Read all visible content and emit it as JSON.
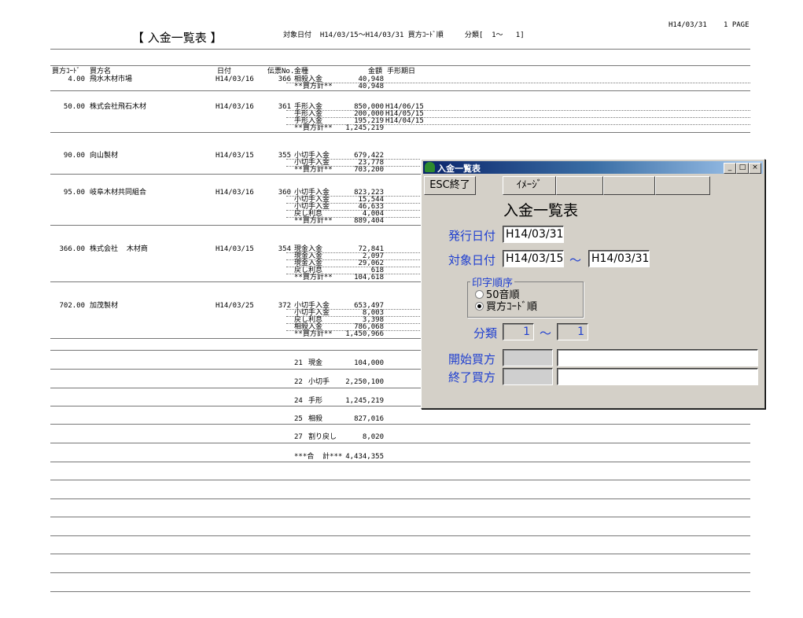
{
  "report": {
    "title": "【 入金一覧表 】",
    "criteria": "対象日付  H14/03/15～H14/03/31 買方ｺｰﾄﾞ順     分類[  1～   1]",
    "print_date": "H14/03/31",
    "page": "1 PAGE",
    "headers": {
      "code": "買方ｺｰﾄﾞ",
      "name": "買方名",
      "date": "日付",
      "slip": "伝票No.",
      "kind": "金種",
      "amount": "金額",
      "due": "手形期日"
    },
    "buyers": [
      {
        "code": "4.00",
        "name": "飛水木材市場",
        "date": "H14/03/16",
        "slip": "366",
        "lines": [
          {
            "kind": "相殺入金",
            "amount": "40,948",
            "due": ""
          },
          {
            "kind": "**買方計**",
            "amount": "40,948",
            "due": ""
          }
        ]
      },
      {
        "code": "50.00",
        "name": "株式会社飛石木材",
        "date": "H14/03/16",
        "slip": "361",
        "lines": [
          {
            "kind": "手形入金",
            "amount": "850,000",
            "due": "H14/06/15"
          },
          {
            "kind": "手形入金",
            "amount": "200,000",
            "due": "H14/05/15"
          },
          {
            "kind": "手形入金",
            "amount": "195,219",
            "due": "H14/04/15"
          },
          {
            "kind": "**買方計**",
            "amount": "1,245,219",
            "due": ""
          }
        ]
      },
      {
        "code": "90.00",
        "name": "向山製材",
        "date": "H14/03/15",
        "slip": "355",
        "lines": [
          {
            "kind": "小切手入金",
            "amount": "679,422",
            "due": ""
          },
          {
            "kind": "小切手入金",
            "amount": "23,778",
            "due": ""
          },
          {
            "kind": "**買方計**",
            "amount": "703,200",
            "due": ""
          }
        ]
      },
      {
        "code": "95.00",
        "name": "岐阜木材共同組合",
        "date": "H14/03/16",
        "slip": "360",
        "lines": [
          {
            "kind": "小切手入金",
            "amount": "823,223",
            "due": ""
          },
          {
            "kind": "小切手入金",
            "amount": "15,544",
            "due": ""
          },
          {
            "kind": "小切手入金",
            "amount": "46,633",
            "due": ""
          },
          {
            "kind": "戻し利息",
            "amount": "4,004",
            "due": ""
          },
          {
            "kind": "**買方計**",
            "amount": "889,404",
            "due": ""
          }
        ]
      },
      {
        "code": "366.00",
        "name": "株式会社  木材商",
        "date": "H14/03/15",
        "slip": "354",
        "lines": [
          {
            "kind": "現金入金",
            "amount": "72,841",
            "due": ""
          },
          {
            "kind": "現金入金",
            "amount": "2,097",
            "due": ""
          },
          {
            "kind": "現金入金",
            "amount": "29,062",
            "due": ""
          },
          {
            "kind": "戻し利息",
            "amount": "618",
            "due": ""
          },
          {
            "kind": "**買方計**",
            "amount": "104,618",
            "due": ""
          }
        ]
      },
      {
        "code": "702.00",
        "name": "加茂製材",
        "date": "H14/03/25",
        "slip": "372",
        "lines": [
          {
            "kind": "小切手入金",
            "amount": "653,497",
            "due": ""
          },
          {
            "kind": "小切手入金",
            "amount": "8,003",
            "due": ""
          },
          {
            "kind": "戻し利息",
            "amount": "3,398",
            "due": ""
          },
          {
            "kind": "相殺入金",
            "amount": "786,068",
            "due": ""
          },
          {
            "kind": "**買方計**",
            "amount": "1,450,966",
            "due": ""
          }
        ]
      }
    ],
    "summary": [
      {
        "code": "21",
        "kind": "現金",
        "amount": "104,000"
      },
      {
        "code": "22",
        "kind": "小切手",
        "amount": "2,250,100"
      },
      {
        "code": "24",
        "kind": "手形",
        "amount": "1,245,219"
      },
      {
        "code": "25",
        "kind": "相殺",
        "amount": "827,016"
      },
      {
        "code": "27",
        "kind": "割り戻し",
        "amount": "8,020"
      }
    ],
    "grand_total_label": "***合  計***",
    "grand_total": "4,434,355"
  },
  "dialog": {
    "window_title": "入金一覧表",
    "buttons": {
      "exit": "ESC終了",
      "image": "ｲﾒｰｼﾞ"
    },
    "caption_controls": {
      "minimize": "_",
      "maximize": "□",
      "close": "×"
    },
    "heading": "入金一覧表",
    "issue_date_label": "発行日付",
    "issue_date": "H14/03/31",
    "target_date_label": "対象日付",
    "target_from": "H14/03/15",
    "range_sep": "～",
    "target_to": "H14/03/31",
    "print_order_label": "印字順序",
    "order_options": [
      "50音順",
      "買方ｺｰﾄﾞ順"
    ],
    "order_selected": 1,
    "category_label": "分類",
    "category_from": "1",
    "category_to": "1",
    "start_buyer_label": "開始買方",
    "end_buyer_label": "終了買方",
    "start_buyer_code": "",
    "start_buyer_name": "",
    "end_buyer_code": "",
    "end_buyer_name": ""
  }
}
